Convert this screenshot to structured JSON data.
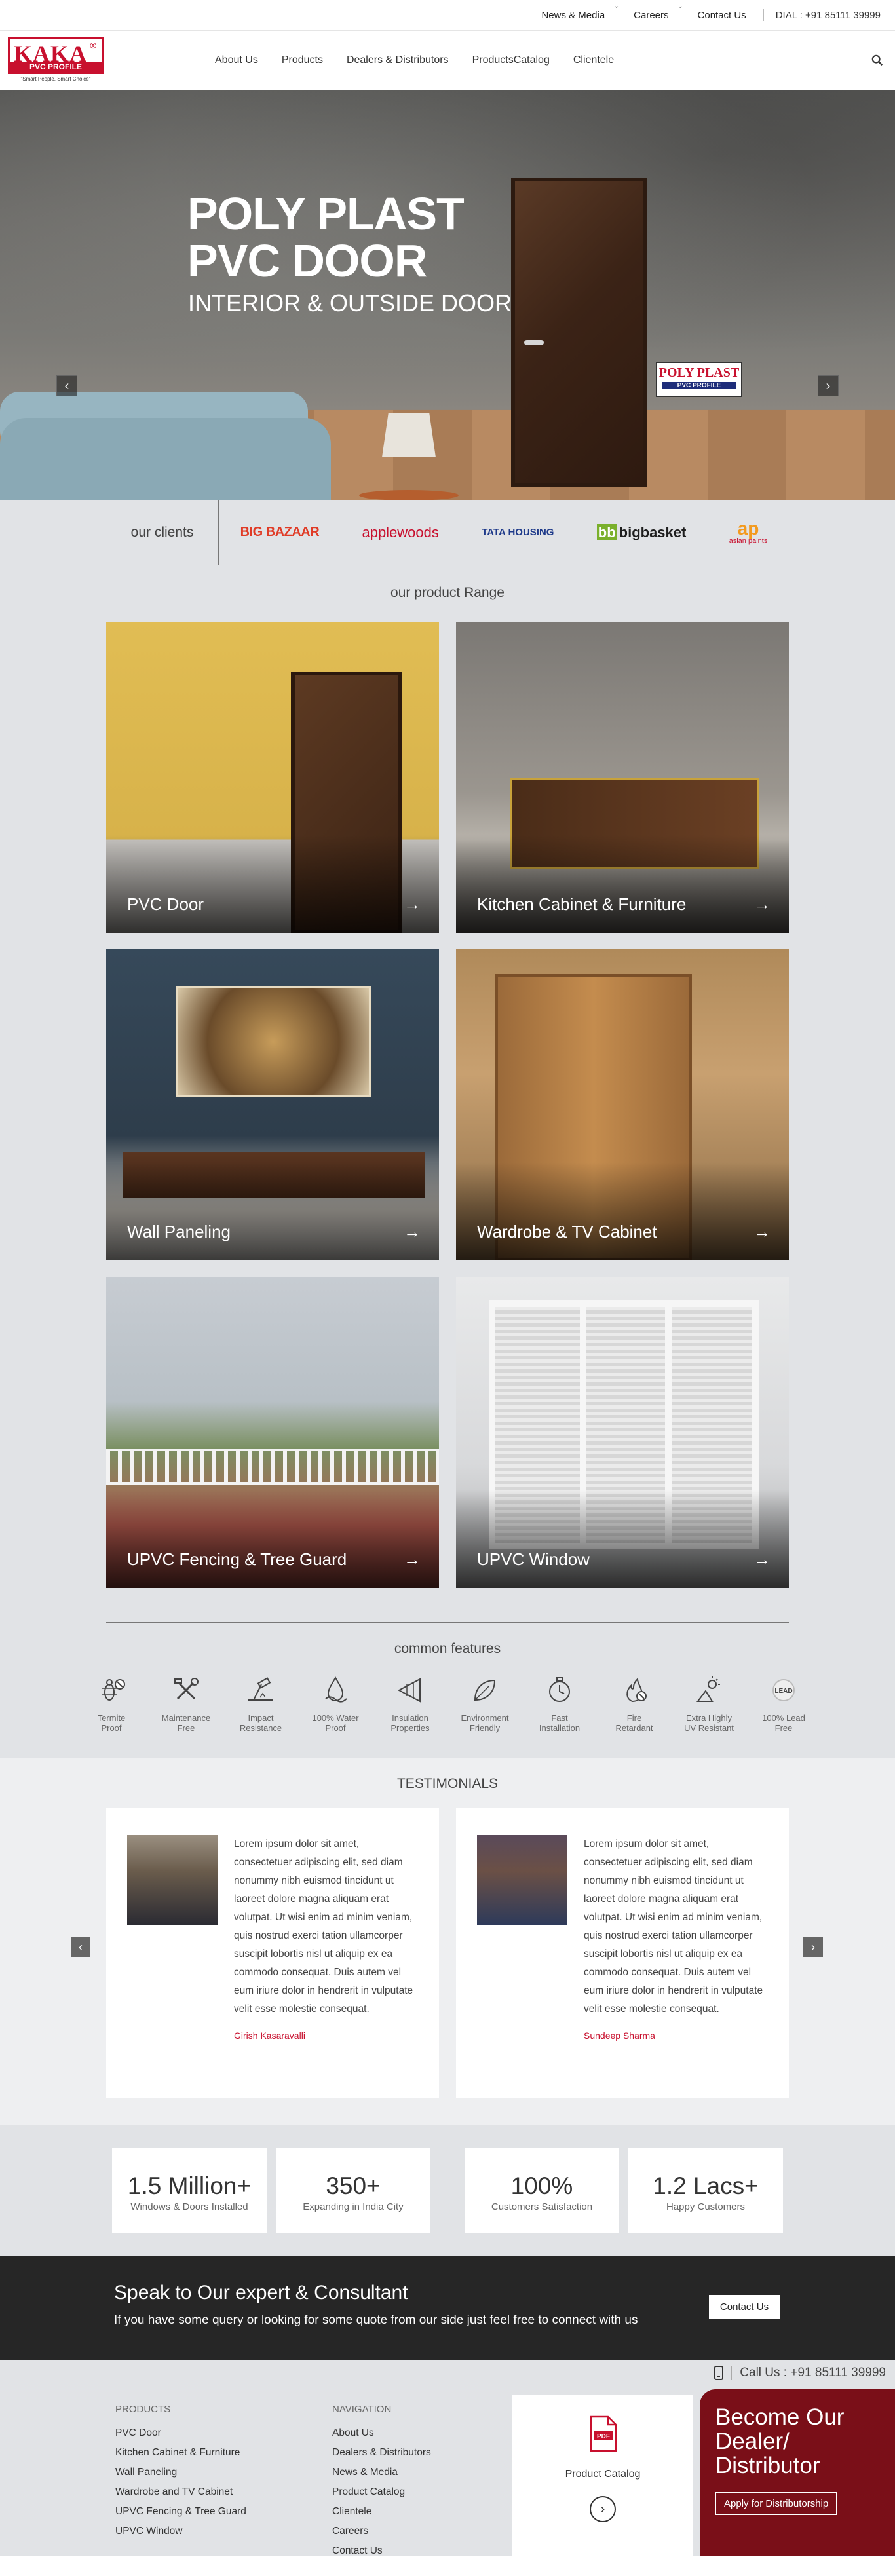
{
  "topbar": {
    "links": [
      "News & Media",
      "Careers",
      "Contact Us"
    ],
    "dial": "DIAL : +91 85111 39999"
  },
  "logo": {
    "brand": "KAKA",
    "sub": "PVC PROFILE",
    "tagline": "\"Smart People, Smart Choice\""
  },
  "nav": {
    "items": [
      "About Us",
      "Products",
      "Dealers & Distributors",
      "ProductsCatalog",
      "Clientele"
    ]
  },
  "hero": {
    "title_line1": "POLY PLAST",
    "title_line2": "PVC DOOR",
    "subtitle": "INTERIOR & OUTSIDE DOOR",
    "badge_brand": "POLY PLAST",
    "badge_sub": "PVC PROFILE"
  },
  "clients": {
    "label": "our clients",
    "logos": [
      "BIG BAZAAR",
      "applewoods",
      "TATA HOUSING",
      "bigbasket",
      "asian paints"
    ]
  },
  "products": {
    "title": "our product Range",
    "items": [
      "PVC Door",
      "Kitchen Cabinet & Furniture",
      "Wall Paneling",
      "Wardrobe & TV Cabinet",
      "UPVC Fencing & Tree Guard",
      "UPVC Window"
    ]
  },
  "features": {
    "title": "common features",
    "items": [
      {
        "l1": "Termite",
        "l2": "Proof",
        "icon": "termite-icon"
      },
      {
        "l1": "Maintenance",
        "l2": "Free",
        "icon": "tools-icon"
      },
      {
        "l1": "Impact",
        "l2": "Resistance",
        "icon": "impact-icon"
      },
      {
        "l1": "100% Water",
        "l2": "Proof",
        "icon": "water-icon"
      },
      {
        "l1": "Insulation",
        "l2": "Properties",
        "icon": "insulation-icon"
      },
      {
        "l1": "Environment",
        "l2": "Friendly",
        "icon": "leaf-icon"
      },
      {
        "l1": "Fast",
        "l2": "Installation",
        "icon": "timer-icon"
      },
      {
        "l1": "Fire",
        "l2": "Retardant",
        "icon": "fire-icon"
      },
      {
        "l1": "Extra Highly",
        "l2": "UV Resistant",
        "icon": "uv-icon"
      },
      {
        "l1": "100% Lead",
        "l2": "Free",
        "icon": "lead-icon"
      }
    ]
  },
  "testimonials": {
    "title": "TESTIMONIALS",
    "items": [
      {
        "text": "Lorem ipsum dolor sit amet, consectetuer adipiscing elit, sed diam nonummy nibh euismod tincidunt ut laoreet dolore magna aliquam erat volutpat. Ut wisi enim ad minim veniam, quis nostrud exerci tation ullamcorper suscipit lobortis nisl ut aliquip ex ea commodo consequat. Duis autem vel eum iriure dolor in hendrerit in vulputate velit esse molestie consequat.",
        "name": "Girish Kasaravalli"
      },
      {
        "text": "Lorem ipsum dolor sit amet, consectetuer adipiscing elit, sed diam nonummy nibh euismod tincidunt ut laoreet dolore magna aliquam erat volutpat. Ut wisi enim ad minim veniam, quis nostrud exerci tation ullamcorper suscipit lobortis nisl ut aliquip ex ea commodo consequat. Duis autem vel eum iriure dolor in hendrerit in vulputate velit esse molestie consequat.",
        "name": "Sundeep Sharma"
      }
    ]
  },
  "stats": [
    {
      "num": "1.5 Million+",
      "label": "Windows & Doors Installed"
    },
    {
      "num": "350+",
      "label": "Expanding in India City"
    },
    {
      "num": "100%",
      "label": "Customers Satisfaction"
    },
    {
      "num": "1.2 Lacs+",
      "label": "Happy Customers"
    }
  ],
  "cta": {
    "title": "Speak to Our expert & Consultant",
    "text": "If you have some query or looking for some quote from our side just feel free to connect with us",
    "button": "Contact Us"
  },
  "footer": {
    "call": "Call Us : +91 85111 39999",
    "products_title": "PRODUCTS",
    "products": [
      "PVC Door",
      "Kitchen Cabinet & Furniture",
      "Wall Paneling",
      "Wardrobe and TV Cabinet",
      "UPVC Fencing & Tree Guard",
      "UPVC Window"
    ],
    "nav_title": "NAVIGATION",
    "nav": [
      "About Us",
      "Dealers & Distributors",
      "News & Media",
      "Product Catalog",
      "Clientele",
      "Careers",
      "Contact Us"
    ],
    "catalog_title": "Product Catalog",
    "dealer_line1": "Become Our",
    "dealer_line2": "Dealer/",
    "dealer_line3": "Distributor",
    "dealer_button": "Apply for Distributorship"
  },
  "colors": {
    "brand_red": "#c8102e",
    "dark": "#262626",
    "maroon": "#7a0f18",
    "bg_gray": "#e1e3e6"
  }
}
